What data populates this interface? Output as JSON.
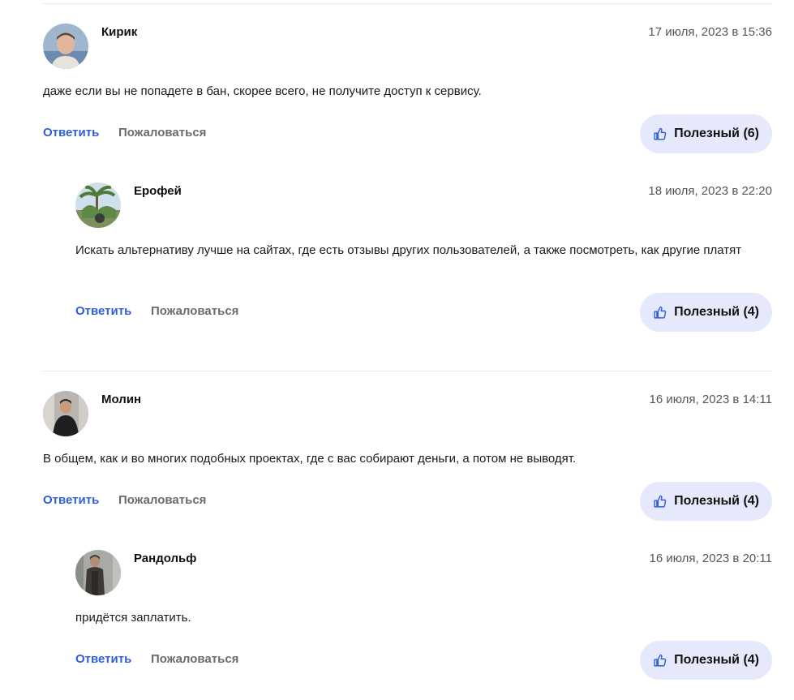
{
  "comments": [
    {
      "author": "Кирик",
      "date": "17 июля, 2023 в 15:36",
      "text": "даже если вы не попадете в бан, скорее всего, не получите доступ к сервису.",
      "reply_label": "Ответить",
      "report_label": "Пожаловаться",
      "helpful_label": "Полезный (6)",
      "helpful_count": 6
    },
    {
      "author": "Ерофей",
      "date": "18 июля, 2023 в 22:20",
      "text": "Искать альтернативу лучше на сайтах, где есть отзывы других пользователей, а также посмотреть, как другие платят",
      "reply_label": "Ответить",
      "report_label": "Пожаловаться",
      "helpful_label": "Полезный (4)",
      "helpful_count": 4
    },
    {
      "author": "Молин",
      "date": "16 июля, 2023 в 14:11",
      "text": "В общем, как и во многих подобных проектах, где с вас собирают деньги, а потом не выводят.",
      "reply_label": "Ответить",
      "report_label": "Пожаловаться",
      "helpful_label": "Полезный (4)",
      "helpful_count": 4
    },
    {
      "author": "Рандольф",
      "date": "16 июля, 2023 в 20:11",
      "text": "придётся заплатить.",
      "reply_label": "Ответить",
      "report_label": "Пожаловаться",
      "helpful_label": "Полезный (4)",
      "helpful_count": 4
    }
  ],
  "colors": {
    "link_blue": "#2f5fd6",
    "report_gray": "#6b6b6b",
    "helpful_bg": "#e6e9fb",
    "divider": "#e6e6e6"
  },
  "icons": {
    "helpful": "thumbs-up-icon"
  }
}
